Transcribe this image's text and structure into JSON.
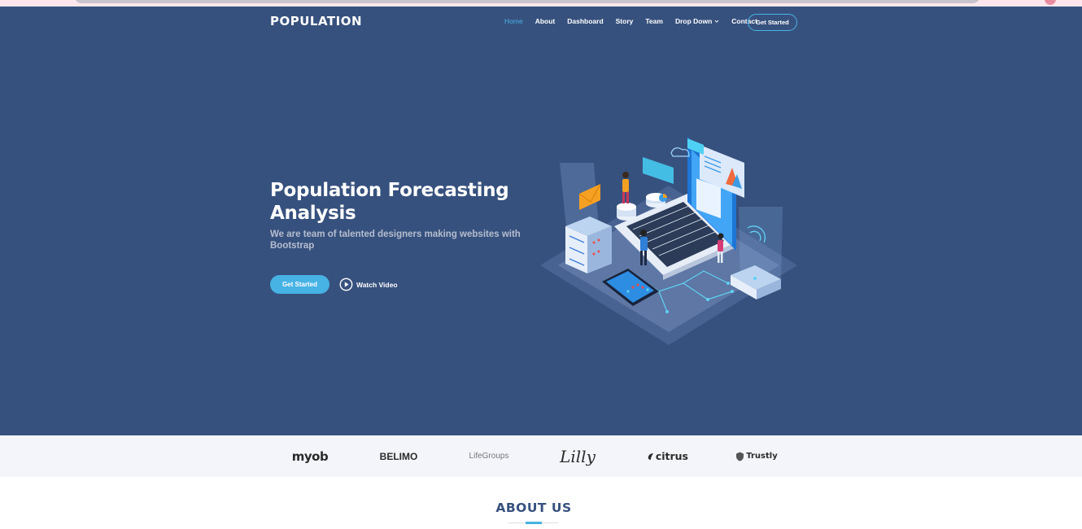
{
  "brand": {
    "logo": "POPULATION"
  },
  "nav": {
    "items": [
      {
        "label": "Home",
        "active": true
      },
      {
        "label": "About"
      },
      {
        "label": "Dashboard"
      },
      {
        "label": "Story"
      },
      {
        "label": "Team"
      },
      {
        "label": "Drop Down",
        "icon": "chevron-down-icon"
      },
      {
        "label": "Contact"
      }
    ],
    "cta": "Get Started"
  },
  "hero": {
    "title": "Population Forecasting Analysis",
    "subtitle": "We are team of talented designers making websites with Bootstrap",
    "primary_button": "Get Started",
    "video_button": "Watch Video",
    "video_icon": "play-circle-icon"
  },
  "clients": {
    "logos": [
      "myob",
      "BELIMO",
      "LifeGroups",
      "Lilly",
      "citrus",
      "Trustly"
    ]
  },
  "about": {
    "title": "ABOUT US"
  },
  "colors": {
    "hero_bg": "#37517e",
    "accent": "#47b2e4",
    "clients_bg": "#f3f5fa",
    "heading": "#37517e"
  }
}
